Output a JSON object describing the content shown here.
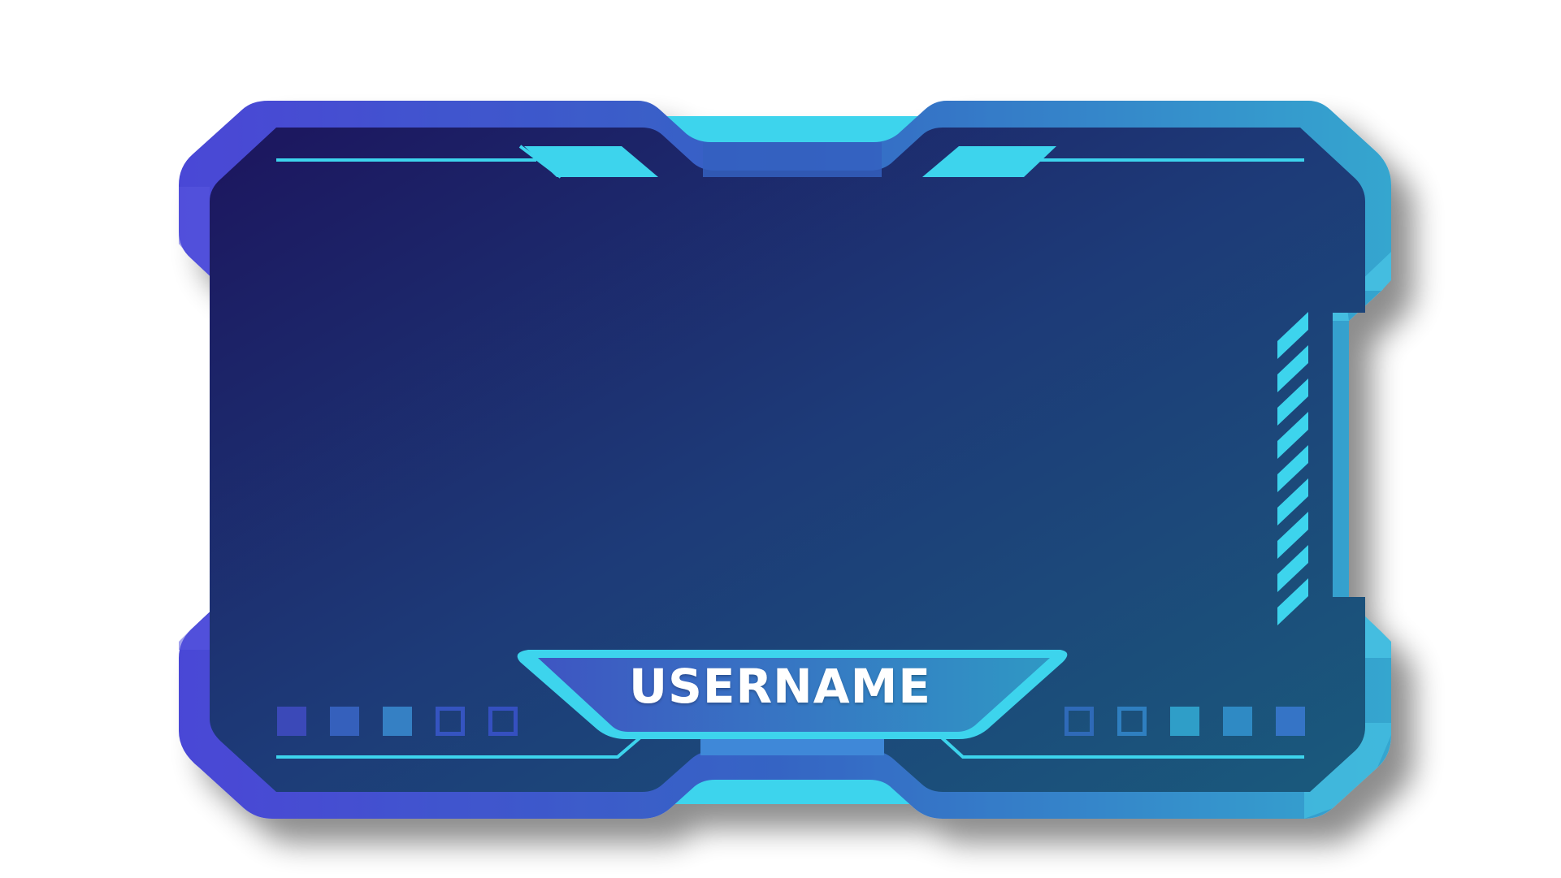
{
  "overlay": {
    "username_label": "USERNAME"
  },
  "colors": {
    "border_left": "#4a47d6",
    "border_mid": "#3565c4",
    "border_right": "#34a6cf",
    "accent_cyan": "#3dd4ed",
    "screen_top_left": "#1c155e",
    "screen_bottom_right": "#1a5a7c",
    "nameplate_left": "#3e55c2",
    "nameplate_right": "#2f98c4"
  },
  "decor": {
    "left_squares": [
      "filled",
      "filled",
      "filled",
      "outline",
      "outline"
    ],
    "right_squares": [
      "outline",
      "outline",
      "filled",
      "filled",
      "filled"
    ],
    "right_stripe_count": 9
  }
}
